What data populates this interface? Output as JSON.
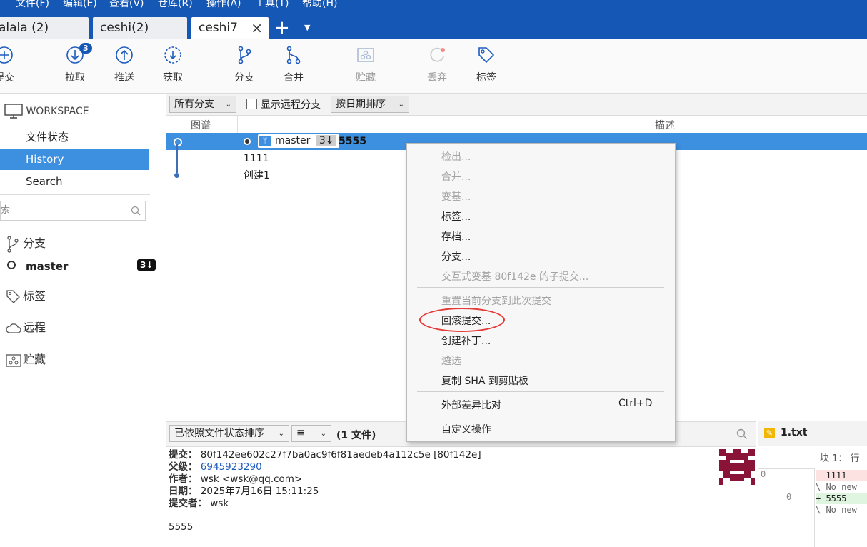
{
  "menu": {
    "items": [
      "文件(F)",
      "编辑(E)",
      "查看(V)",
      "仓库(R)",
      "操作(A)",
      "工具(T)",
      "帮助(H)"
    ]
  },
  "tabs": [
    {
      "label": "alala (2)"
    },
    {
      "label": "ceshi(2)"
    },
    {
      "label": "ceshi7",
      "active": true
    }
  ],
  "toolbar": {
    "commit": "提交",
    "pull": "拉取",
    "pull_badge": "3",
    "push": "推送",
    "fetch": "获取",
    "branch": "分支",
    "merge": "合并",
    "stash": "贮藏",
    "discard": "丢弃",
    "tag": "标签"
  },
  "sidebar": {
    "workspace": "WORKSPACE",
    "items": [
      "文件状态",
      "History",
      "Search"
    ],
    "search_placeholder": "索",
    "branches_title": "分支",
    "branch": {
      "name": "master",
      "badge": "3↓"
    },
    "tags_title": "标签",
    "remotes_title": "远程",
    "stashes_title": "贮藏"
  },
  "filter": {
    "branches": "所有分支",
    "show_remote": "显示远程分支",
    "sort": "按日期排序"
  },
  "columns": {
    "graph": "图谱",
    "description": "描述"
  },
  "commits": [
    {
      "branch": "master",
      "behind": "3↓",
      "message": "5555",
      "selected": true
    },
    {
      "message": "1111"
    },
    {
      "message": "创建1"
    }
  ],
  "context_menu": {
    "group1": [
      {
        "label": "检出...",
        "disabled": true
      },
      {
        "label": "合并...",
        "disabled": true
      },
      {
        "label": "变基...",
        "disabled": true
      },
      {
        "label": "标签...",
        "disabled": false
      },
      {
        "label": "存档...",
        "disabled": false
      },
      {
        "label": "分支...",
        "disabled": false
      },
      {
        "label": "交互式变基 80f142e 的子提交...",
        "disabled": true
      }
    ],
    "group2": [
      {
        "label": "重置当前分支到此次提交",
        "disabled": true
      },
      {
        "label": "回滚提交...",
        "disabled": false,
        "highlighted": true
      },
      {
        "label": "创建补丁...",
        "disabled": false
      },
      {
        "label": "遴选",
        "disabled": true
      },
      {
        "label": "复制 SHA 到剪贴板",
        "disabled": false
      }
    ],
    "external_diff": {
      "label": "外部差异比对",
      "shortcut": "Ctrl+D"
    },
    "custom_actions": "自定义操作"
  },
  "lower": {
    "sort": "已依照文件状态排序",
    "file_count": "(1 文件)"
  },
  "details": {
    "commit_label": "提交：",
    "commit_value": "80f142ee602c27f7ba0ac9f6f81aedeb4a112c5e [80f142e]",
    "parent_label": "父级：",
    "parent_value": "6945923290",
    "author_label": "作者：",
    "author_value": "wsk <wsk@qq.com>",
    "date_label": "日期：",
    "date_value": "2025年7月16日 15:11:25",
    "committer_label": "提交者：",
    "committer_value": "wsk",
    "message": "5555"
  },
  "file_panel": {
    "filename": "1.txt",
    "hunk": "块 1： 行",
    "line_old": "0",
    "line_new": "0",
    "diff": [
      "- 1111",
      "\\ No new",
      "+ 5555",
      "\\ No new"
    ]
  },
  "colors": {
    "accent": "#1557b5",
    "selection": "#3d8fdf",
    "annotation": "#e53935"
  }
}
